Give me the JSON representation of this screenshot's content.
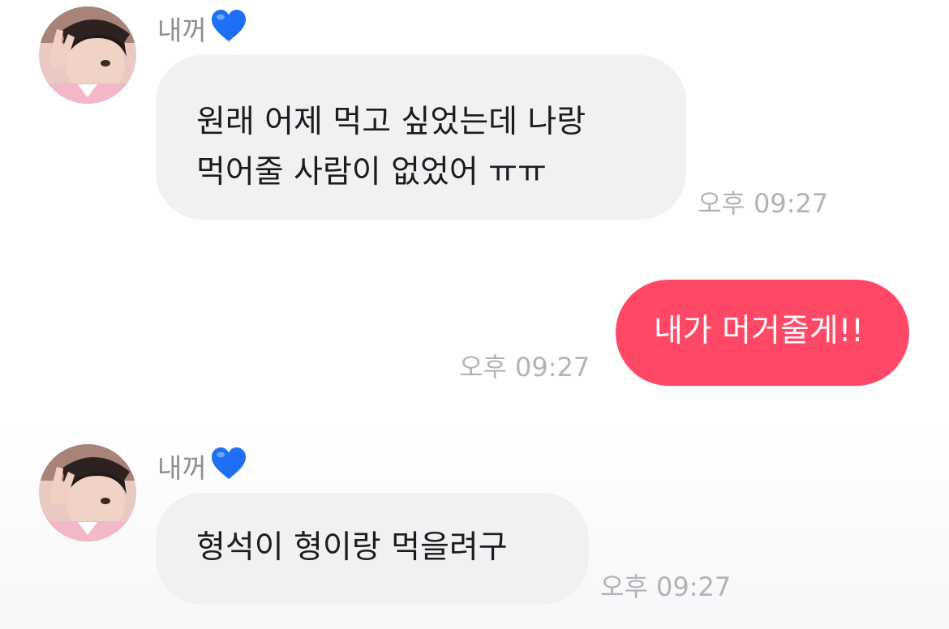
{
  "conversation": {
    "messages": [
      {
        "sender_name": "내꺼",
        "sender_badge_icon": "blue-heart-icon",
        "text_lines": [
          "원래 어제 먹고 싶었는데 나랑",
          "먹어줄 사람이 없었어 ㅠㅠ"
        ],
        "time": "오후 09:27"
      },
      {
        "text": "내가 머거줄게!!",
        "time": "오후 09:27"
      },
      {
        "sender_name": "내꺼",
        "sender_badge_icon": "blue-heart-icon",
        "text": "형석이 형이랑 먹을려구",
        "time": "오후 09:27"
      }
    ]
  },
  "colors": {
    "incoming_bubble": "#f1f1f4",
    "outgoing_bubble": "#ff4867",
    "timestamp": "#b2b2b7",
    "sender_name": "#8e8e93",
    "heart": "#1e6ff5"
  }
}
